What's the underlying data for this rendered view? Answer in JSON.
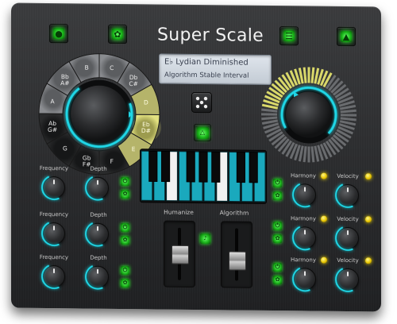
{
  "app": {
    "title": "Super Scale"
  },
  "display": {
    "line1": "E♭  Lydian Diminished",
    "line2": "Algorithm Stable Interval"
  },
  "toolbar": {
    "power_icon": "power-icon",
    "settings_icon": "gear-icon",
    "mixer_icon": "sliders-icon",
    "warning_icon": "warning-icon"
  },
  "note_wheel": {
    "notes": [
      "C",
      "Db C#",
      "D",
      "Eb D#",
      "E",
      "F",
      "Gb F#",
      "G",
      "Ab G#",
      "A",
      "Bb A#",
      "B"
    ],
    "selected": "Eb D#"
  },
  "rows_left": [
    {
      "freq_label": "Frequency",
      "depth_label": "Depth"
    },
    {
      "freq_label": "Frequency",
      "depth_label": "Depth"
    },
    {
      "freq_label": "Frequency",
      "depth_label": "Depth"
    }
  ],
  "rows_right": [
    {
      "harmony_label": "Harmony",
      "velocity_label": "Velocity"
    },
    {
      "harmony_label": "Harmony",
      "velocity_label": "Velocity"
    },
    {
      "harmony_label": "Harmony",
      "velocity_label": "Velocity"
    }
  ],
  "sliders": {
    "humanize_label": "Humanize",
    "algorithm_label": "Algorithm",
    "humanize_level": 0.5,
    "algorithm_level": 0.35
  },
  "colors": {
    "accent_cyan": "#20d6e6",
    "led_green": "#35ff35",
    "highlight_yellow": "#d9d86a",
    "led_yellow": "#ffe000"
  }
}
